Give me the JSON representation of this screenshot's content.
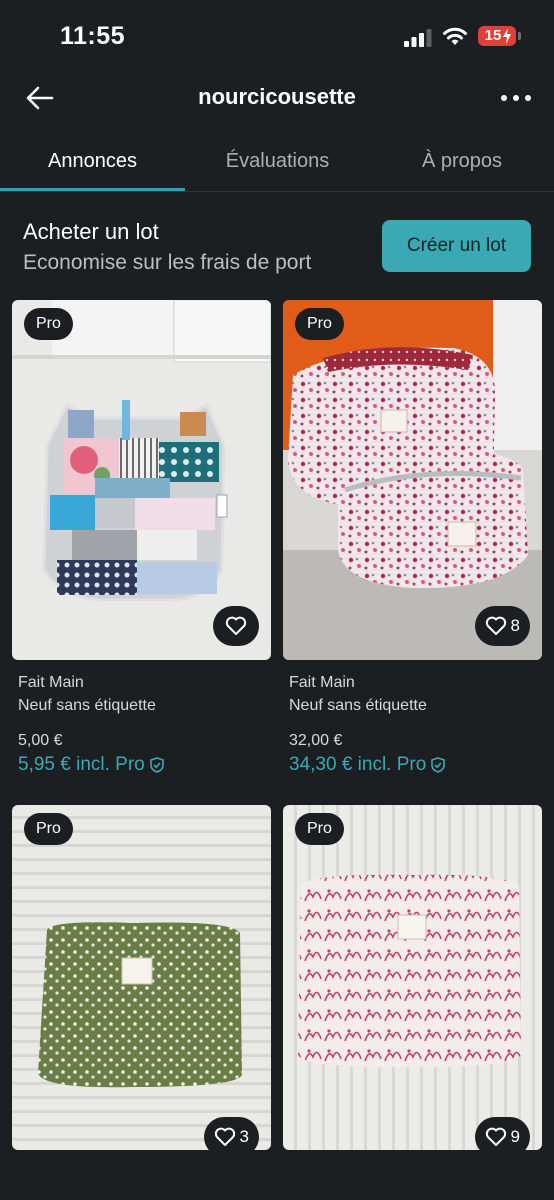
{
  "status_bar": {
    "time": "11:55",
    "battery": "15"
  },
  "header": {
    "title": "nourcicousette"
  },
  "tabs": [
    {
      "label": "Annonces"
    },
    {
      "label": "Évaluations"
    },
    {
      "label": "À propos"
    }
  ],
  "bundle": {
    "title": "Acheter un lot",
    "subtitle": "Economise sur les frais de port",
    "button": "Créer un lot"
  },
  "items": [
    {
      "badge": "Pro",
      "favorites": "",
      "brand": "Fait Main",
      "condition": "Neuf sans étiquette",
      "price": "5,00 €",
      "price_pro": "5,95 € incl. Pro"
    },
    {
      "badge": "Pro",
      "favorites": "8",
      "brand": "Fait Main",
      "condition": "Neuf sans étiquette",
      "price": "32,00 €",
      "price_pro": "34,30 € incl. Pro"
    },
    {
      "badge": "Pro",
      "favorites": "3"
    },
    {
      "badge": "Pro",
      "favorites": "9"
    }
  ],
  "colors": {
    "background": "#1b1f22",
    "accent": "#3ba9b3",
    "battery": "#e0403a"
  }
}
